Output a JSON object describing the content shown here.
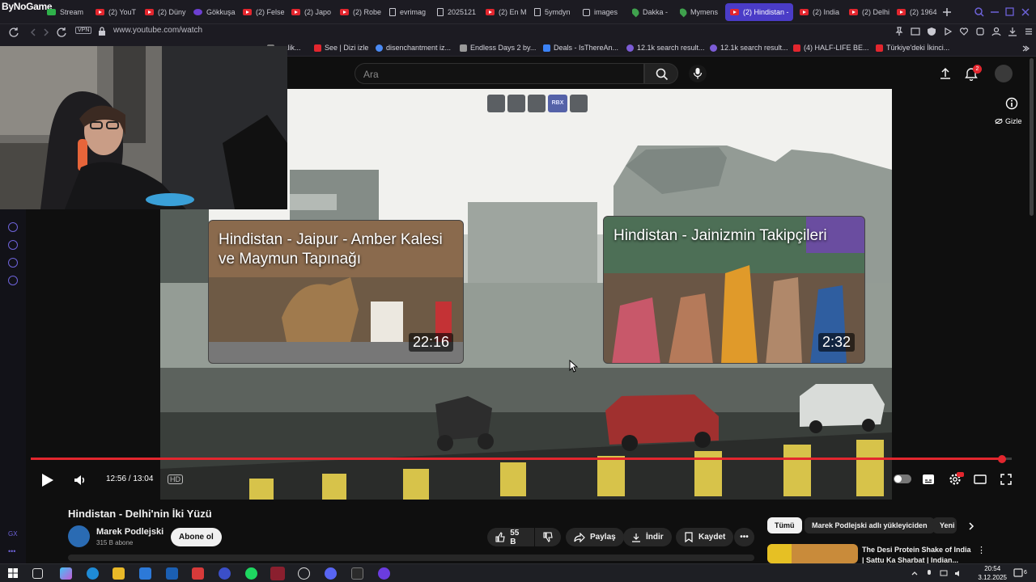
{
  "browser": {
    "brand": "ByNoGame",
    "tabs": [
      {
        "label": "Stream",
        "icon": "grid-icon"
      },
      {
        "label": "(2) YouT",
        "icon": "youtube-icon"
      },
      {
        "label": "(2) Düny",
        "icon": "youtube-icon"
      },
      {
        "label": "Gökkuşa",
        "icon": "s-icon"
      },
      {
        "label": "(2) Felse",
        "icon": "youtube-icon"
      },
      {
        "label": "(2) Japo",
        "icon": "youtube-icon"
      },
      {
        "label": "(2) Robe",
        "icon": "youtube-icon"
      },
      {
        "label": "evrimag",
        "icon": "web-icon"
      },
      {
        "label": "2025121",
        "icon": "document-icon"
      },
      {
        "label": "(2) En M",
        "icon": "youtube-icon"
      },
      {
        "label": "5ymdyn",
        "icon": "document-icon"
      },
      {
        "label": "images",
        "icon": "image-icon"
      },
      {
        "label": "Dakka -",
        "icon": "map-pin-icon"
      },
      {
        "label": "Mymens",
        "icon": "map-pin-icon"
      },
      {
        "label": "(2) Hindistan -",
        "icon": "youtube-icon",
        "active": true
      },
      {
        "label": "(2) India",
        "icon": "youtube-icon"
      },
      {
        "label": "(2) Delhi",
        "icon": "youtube-icon"
      },
      {
        "label": "(2) 1964",
        "icon": "youtube-icon"
      }
    ],
    "vpn_badge": "VPN",
    "url": "www.youtube.com/watch",
    "bookmarks": [
      {
        "label": "...alik...",
        "icon": "web-icon"
      },
      {
        "label": "See | Dizi izle",
        "icon": "arrow-icon"
      },
      {
        "label": "disenchantment iz...",
        "icon": "google-icon"
      },
      {
        "label": "Endless Days 2 by...",
        "icon": "image-icon"
      },
      {
        "label": "Deals - IsThereAn...",
        "icon": "deal-icon"
      },
      {
        "label": "12.1k search result...",
        "icon": "circle-icon"
      },
      {
        "label": "12.1k search result...",
        "icon": "circle-icon"
      },
      {
        "label": "(4) HALF-LIFE BE...",
        "icon": "youtube-icon"
      },
      {
        "label": "Türkiye'deki İkinci...",
        "icon": "flag-icon"
      }
    ]
  },
  "youtube": {
    "search_placeholder": "Ara",
    "notification_count": "2",
    "overlay_badge": "RBX",
    "hide_label": "Gizle",
    "endcards": [
      {
        "title": "Hindistan - Jaipur - Amber Kalesi ve Maymun Tapınağı",
        "duration": "22:16"
      },
      {
        "title": "Hindistan - Jainizmin Takipçileri",
        "duration": "2:32"
      }
    ],
    "player": {
      "current_time": "12:56",
      "duration": "13:04",
      "time_display": "12:56 / 13:04",
      "progress_fraction": 0.99,
      "hd_badge": "HD"
    },
    "video": {
      "title": "Hindistan - Delhi'nin İki Yüzü",
      "channel": "Marek Podlejski",
      "subscribers": "315 B abone",
      "subscribe_label": "Abone ol",
      "likes": "55 B",
      "share_label": "Paylaş",
      "download_label": "İndir",
      "save_label": "Kaydet"
    },
    "chips": [
      "Tümü",
      "Marek Podlejski adlı yükleyiciden",
      "Yeni"
    ],
    "recommended": {
      "title_line1": "The Desi Protein Shake of India",
      "title_line2": "| Sattu Ka Sharbat | Indian..."
    }
  },
  "taskbar": {
    "time": "20:54",
    "date": "3.12.2025"
  },
  "colors": {
    "youtube_red": "#e3262e",
    "active_tab": "#4a3cc7",
    "background": "#0f0f0f"
  }
}
